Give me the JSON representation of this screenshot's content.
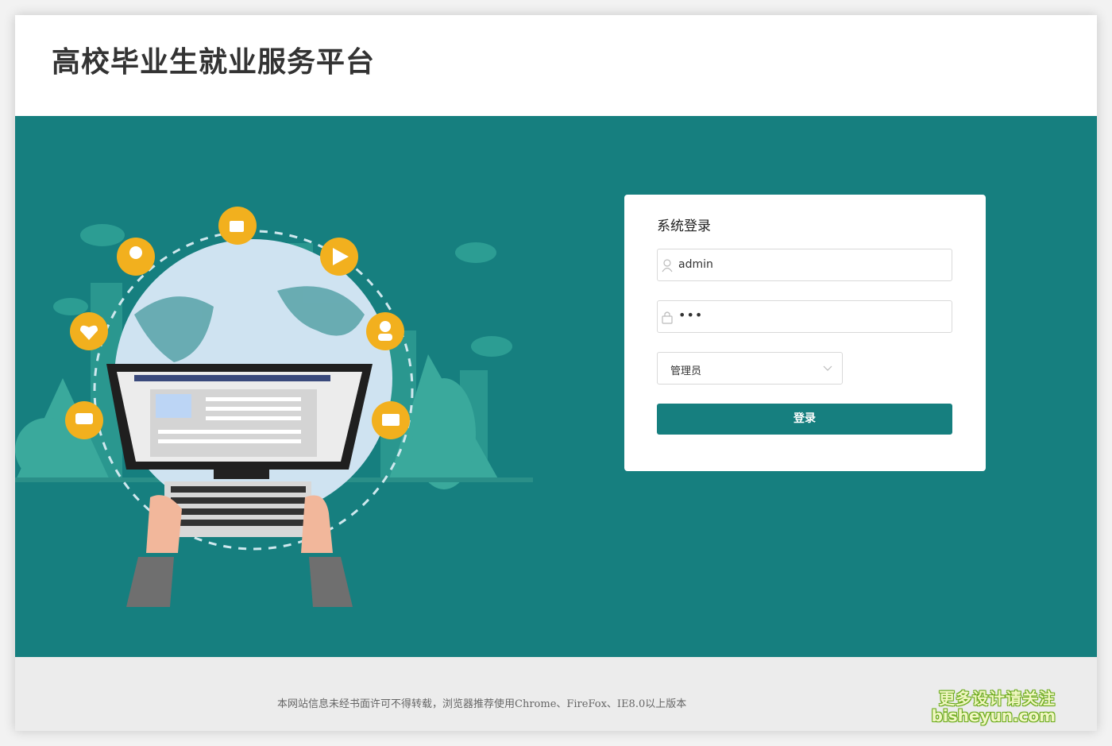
{
  "header": {
    "title": "高校毕业生就业服务平台"
  },
  "login": {
    "title": "系统登录",
    "username_value": "admin",
    "password_mask": "•••",
    "role_selected": "管理员",
    "submit_label": "登录"
  },
  "footer": {
    "notice": "本网站信息未经书面许可不得转载，浏览器推荐使用Chrome、FireFox、IE8.0以上版本"
  },
  "watermark": {
    "line1": "更多设计请关注",
    "line2": "bisheyun.com"
  },
  "colors": {
    "accent": "#167f7f",
    "icon_badge": "#f2b01e"
  }
}
